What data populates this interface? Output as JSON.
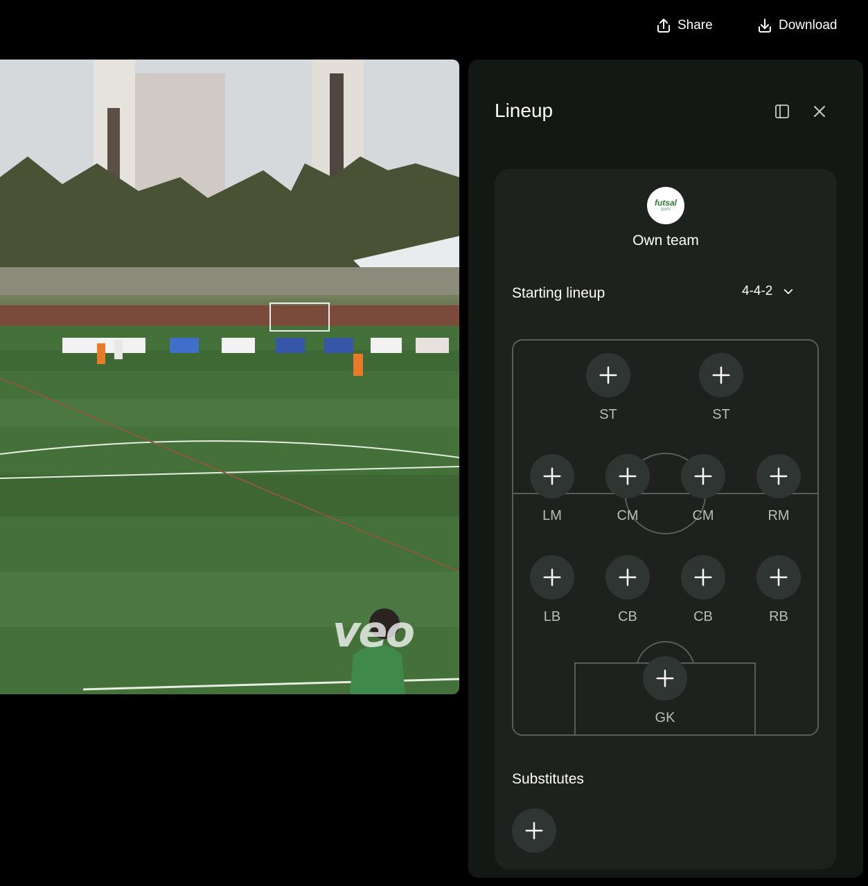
{
  "topbar": {
    "share_label": "Share",
    "download_label": "Download"
  },
  "video": {
    "watermark": "veo"
  },
  "panel": {
    "title": "Lineup",
    "team": {
      "logo_text": "futsal",
      "logo_sub": "park",
      "name": "Own team"
    },
    "starting_lineup_label": "Starting lineup",
    "formation": "4-4-2",
    "positions": {
      "st1": "ST",
      "st2": "ST",
      "lm": "LM",
      "cm1": "CM",
      "cm2": "CM",
      "rm": "RM",
      "lb": "LB",
      "cb1": "CB",
      "cb2": "CB",
      "rb": "RB",
      "gk": "GK"
    },
    "substitutes_label": "Substitutes"
  }
}
